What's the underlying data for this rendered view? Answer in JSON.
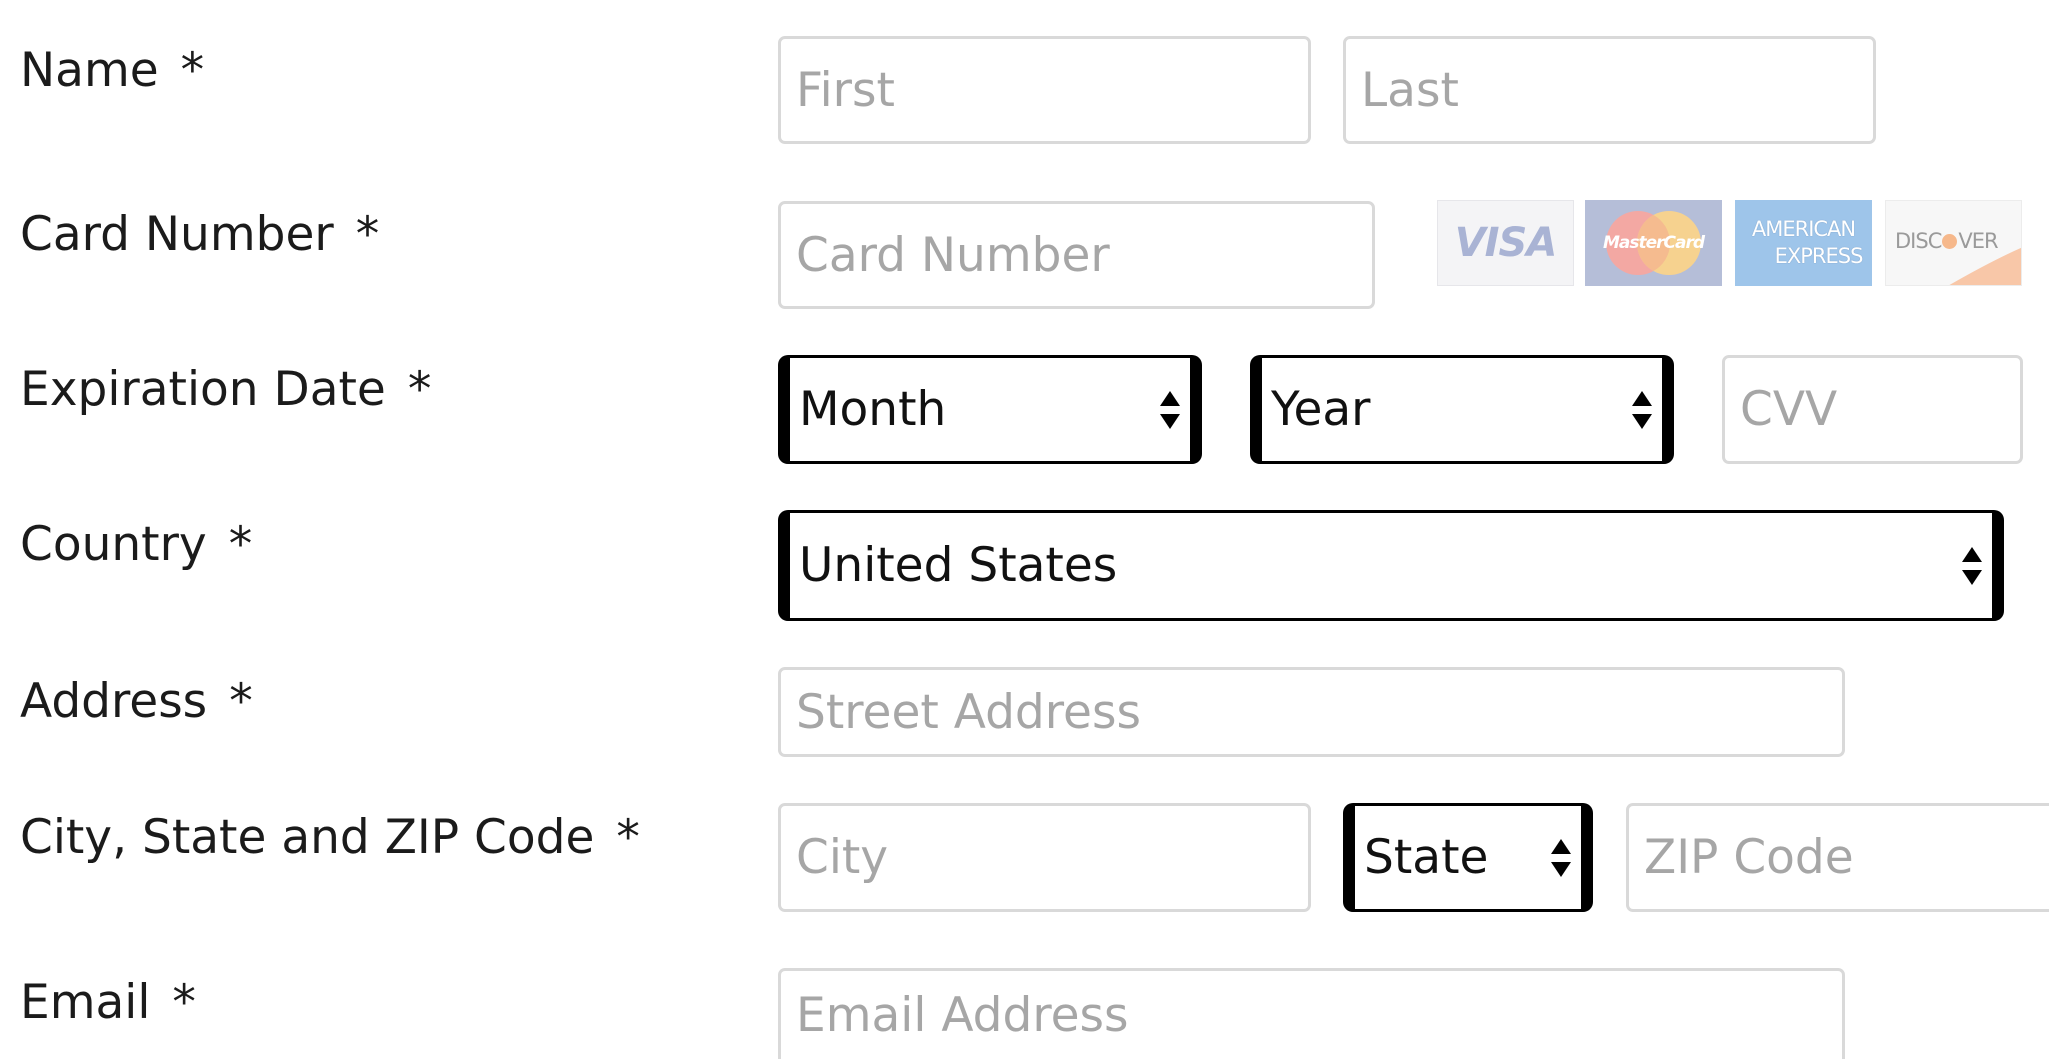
{
  "labels": {
    "name": "Name",
    "card_number": "Card Number",
    "expiration": "Expiration Date",
    "country": "Country",
    "address": "Address",
    "city_state_zip": "City, State and ZIP Code",
    "email": "Email",
    "required_mark": "*"
  },
  "fields": {
    "first_name": {
      "placeholder": "First",
      "value": ""
    },
    "last_name": {
      "placeholder": "Last",
      "value": ""
    },
    "card_number": {
      "placeholder": "Card Number",
      "value": ""
    },
    "cvv": {
      "placeholder": "CVV",
      "value": ""
    },
    "street": {
      "placeholder": "Street Address",
      "value": ""
    },
    "city": {
      "placeholder": "City",
      "value": ""
    },
    "zip": {
      "placeholder": "ZIP Code",
      "value": ""
    },
    "email": {
      "placeholder": "Email Address",
      "value": ""
    }
  },
  "selects": {
    "month": "Month",
    "year": "Year",
    "country": "United States",
    "state": "State"
  },
  "card_logos": {
    "visa": "VISA",
    "mastercard": "MasterCard",
    "amex_line1": "AMERICAN",
    "amex_line2": "EXPRESS",
    "discover_pre": "DISC",
    "discover_post": "VER"
  },
  "colors": {
    "input_border": "#d9d9d9",
    "placeholder": "#a6a6a6",
    "select_border": "#000000"
  }
}
